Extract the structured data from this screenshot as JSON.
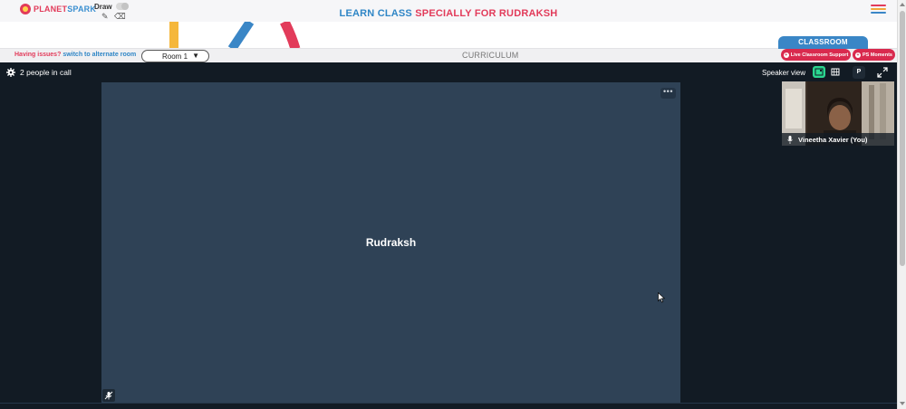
{
  "header": {
    "logo_part1": "PLANET",
    "logo_part2": "SPARK",
    "draw_label": "Draw",
    "title_part1": "LEARN CLASS",
    "title_part2": "SPECIALLY FOR RUDRAKSH",
    "icons": [
      "pencil-icon",
      "eraser-icon",
      "menu-icon"
    ]
  },
  "roombar": {
    "issues_text": "Having issues?",
    "switch_link": "switch to alternate room",
    "room_value": "Room 1",
    "curriculum_label": "CURRICULUM",
    "classroom_tab": "CLASSROOM",
    "support_button": "Live Classroom Support",
    "moments_button": "PS Moments"
  },
  "call": {
    "people_count": "2 people in call",
    "speaker_view_label": "Speaker view",
    "p_button": "P",
    "main_participant": "Rudraksh",
    "more_options": "•••",
    "self_participant": "Vineetha Xavier (You)",
    "active_view": "speaker"
  },
  "colors": {
    "brand_red": "#e23b5a",
    "brand_blue": "#2f86c6",
    "call_background": "#121b24",
    "tile_background": "#2f4256",
    "active_view_green": "#2bd68f"
  }
}
